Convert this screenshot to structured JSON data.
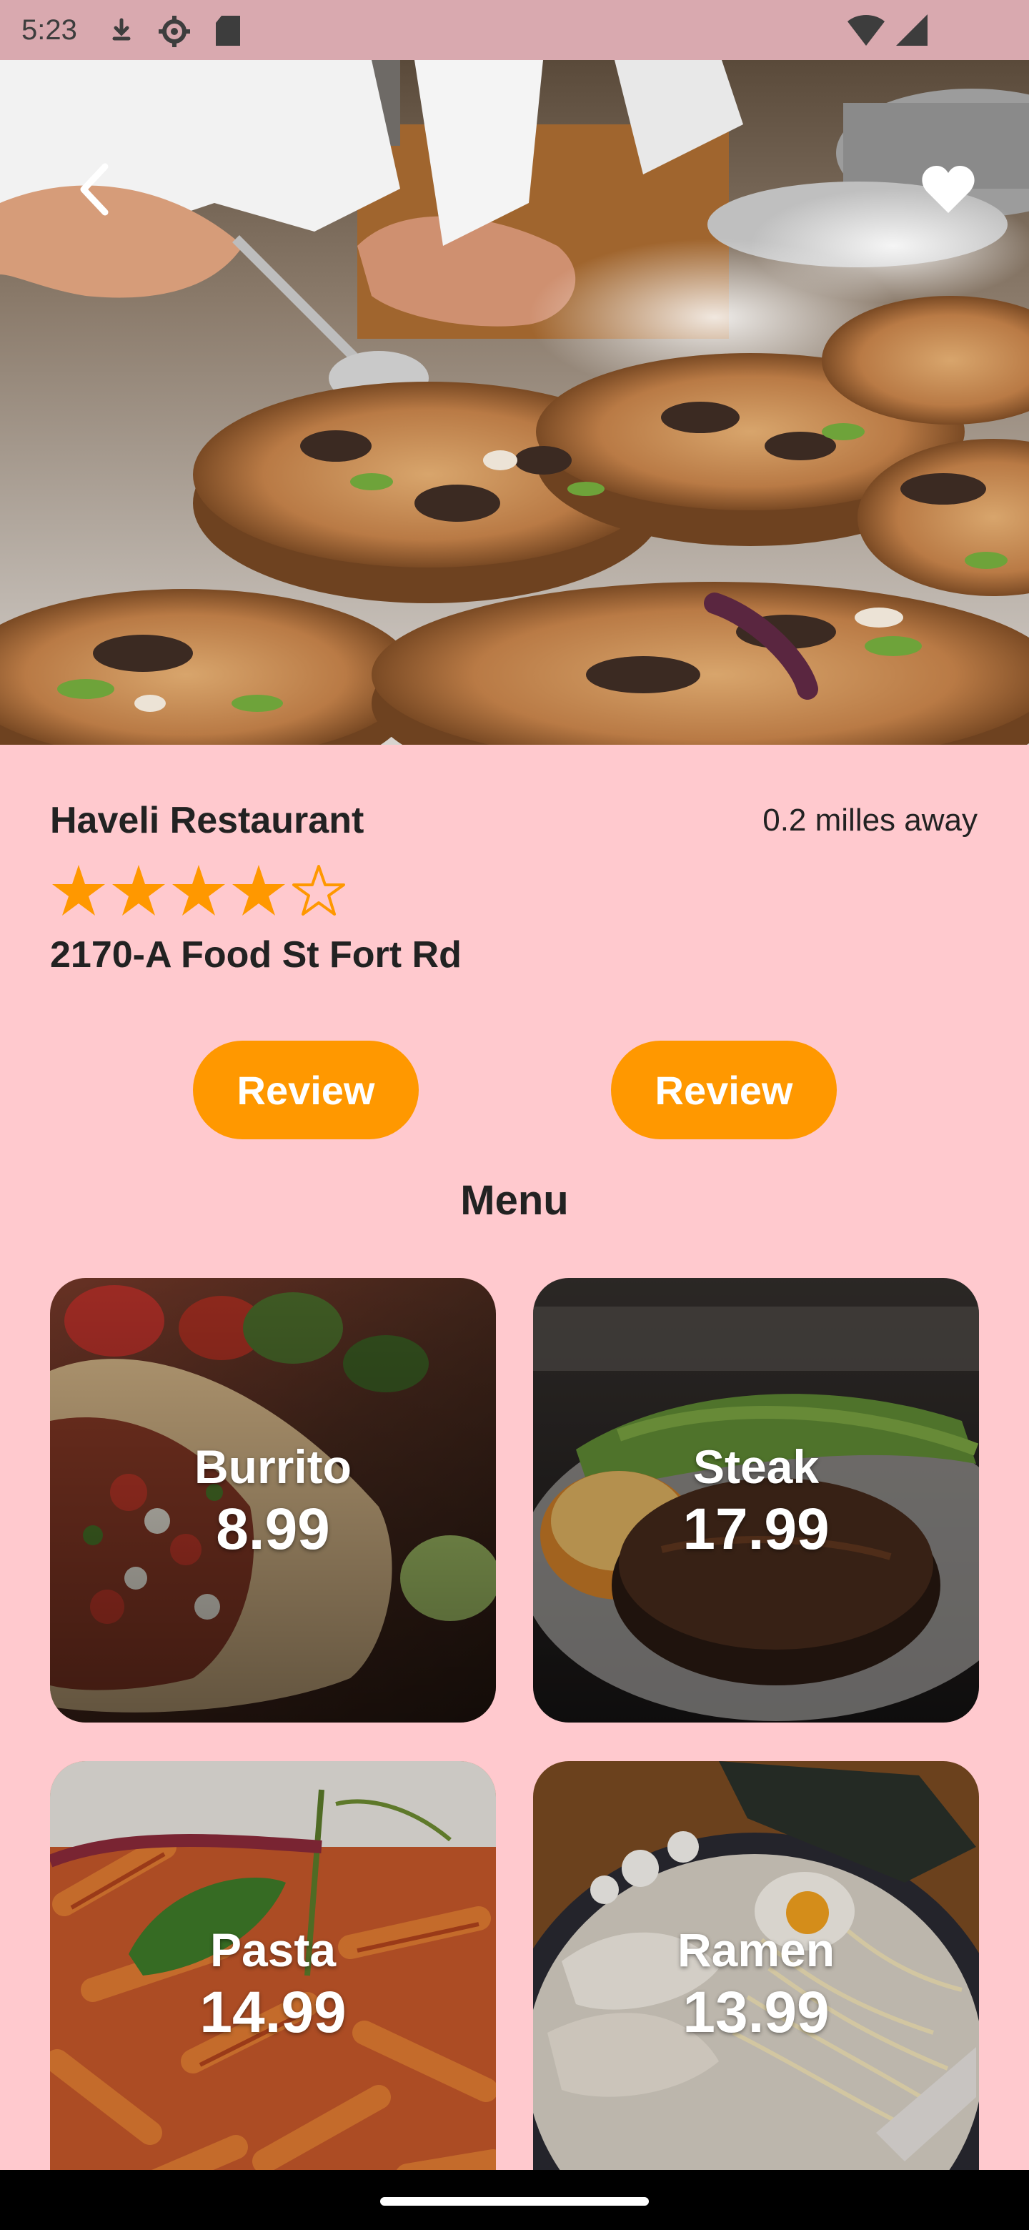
{
  "status_bar": {
    "time": "5:23",
    "icons": [
      "download-icon",
      "settings-icon",
      "sd-card-icon",
      "wifi-icon",
      "signal-icon"
    ]
  },
  "hero": {
    "image": "chef plating dishes on wooden boards",
    "back_icon": "chevron-left-icon",
    "favorite_icon": "heart-icon"
  },
  "restaurant": {
    "name": "Haveli Restaurant",
    "distance": "0.2 milles away",
    "rating": 4,
    "rating_max": 5,
    "address": "2170-A Food St Fort Rd"
  },
  "actions": {
    "review_left": "Review",
    "review_right": "Review"
  },
  "menu": {
    "title": "Menu",
    "items": [
      {
        "name": "Burrito",
        "price": "8.99"
      },
      {
        "name": "Steak",
        "price": "17.99"
      },
      {
        "name": "Pasta",
        "price": "14.99"
      },
      {
        "name": "Ramen",
        "price": "13.99"
      }
    ]
  },
  "colors": {
    "background": "#FFC9CE",
    "status_bar": "#D9A9AF",
    "accent": "#FF9800",
    "text": "#222222"
  }
}
